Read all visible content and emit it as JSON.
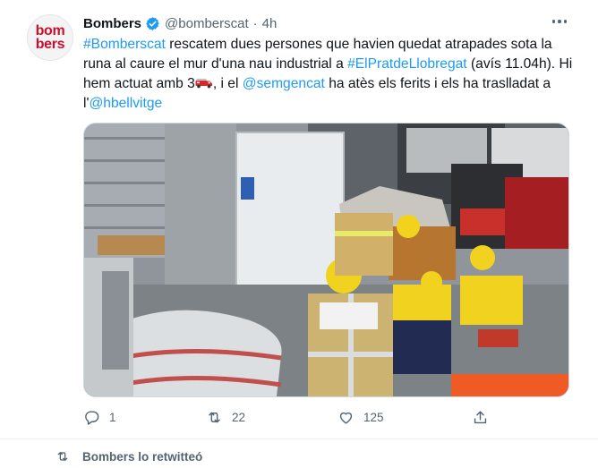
{
  "tweet": {
    "avatar_lines": [
      "bom",
      "bers"
    ],
    "author_name": "Bombers",
    "verified": true,
    "handle": "@bomberscat",
    "separator": "·",
    "time": "4h",
    "text": {
      "hashtag1": "#Bomberscat",
      "part1": " rescatem dues persones que havien quedat atrapades sota la runa al caure el mur d'una nau industrial a ",
      "hashtag2": "#ElPratdeLlobregat",
      "part2": " (avís 11.04h). Hi hem actuat amb 3",
      "part3": ", i el ",
      "mention1": "@semgencat",
      "part4": " ha atès els ferits i els ha traslladat a l'",
      "mention2": "@hbellvitge"
    },
    "emoji": "fire-engine",
    "media": {
      "description_icon": "photo-rescue-scene"
    },
    "actions": {
      "reply_count": "1",
      "retweet_count": "22",
      "like_count": "125"
    }
  },
  "next_item": {
    "retweet_notice": "Bombers lo retwitteó"
  },
  "colors": {
    "link": "#1d9bf0",
    "text": "#0f1419",
    "secondary": "#536471",
    "brand_red": "#c8102e"
  }
}
